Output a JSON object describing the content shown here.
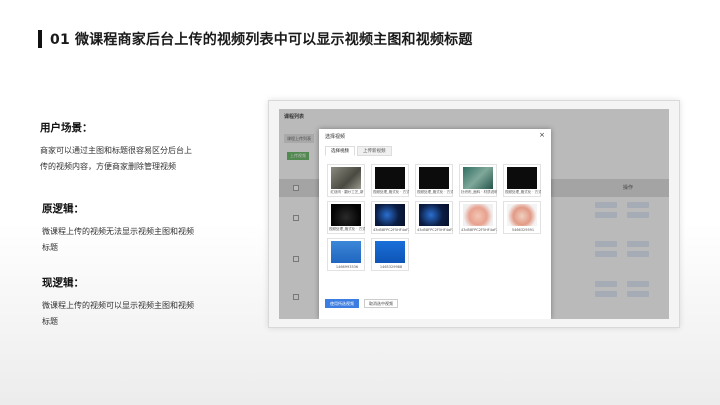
{
  "header": {
    "title": "01 微课程商家后台上传的视频列表中可以显示视频主图和视频标题"
  },
  "sections": {
    "user_scene": {
      "heading": "用户场景：",
      "line1": "商家可以通过主图和标题很容易区分后台上",
      "line2": "传的视频内容，方便商家删除管理视频"
    },
    "original": {
      "heading": "原逻辑：",
      "line1": "微课程上传的视频无法显示视频主图和视频",
      "line2": "标题"
    },
    "current": {
      "heading": "现逻辑：",
      "line1": "微课程上传的视频可以显示视频主图和视频",
      "line2": "标题"
    }
  },
  "screenshot": {
    "bg_title": "课程列表",
    "bg_tab": "课程上传列表",
    "bg_add_button": "上传视频",
    "bg_col_action": "操作",
    "modal": {
      "title": "选择视频",
      "close": "×",
      "tabs": [
        "选择视频",
        "上传新视频"
      ],
      "cards": [
        {
          "thumb": "food",
          "caption": "红烧肉 · 翻炒工艺_新"
        },
        {
          "thumb": "dark",
          "caption": "视频处理_格式化 · 方式"
        },
        {
          "thumb": "dark",
          "caption": "视频处理_格式化 · 方式"
        },
        {
          "thumb": "green",
          "caption": "针织布_面料 · 材质说明"
        },
        {
          "thumb": "dark",
          "caption": "视频处理_格式化 · 方式"
        },
        {
          "thumb": "dotdark",
          "caption": "视频处理_格式化 · 方式"
        },
        {
          "thumb": "blue",
          "caption": "43d58FPC2F5HF4aFX2"
        },
        {
          "thumb": "blue",
          "caption": "43d58FPC2F5HF4aFX2"
        },
        {
          "thumb": "baby",
          "caption": "43d58FPC2F5HF4aFX2"
        },
        {
          "thumb": "baby2",
          "caption": "5466329591"
        },
        {
          "thumb": "blueimg",
          "caption": "1466993536"
        },
        {
          "thumb": "promo",
          "caption": "1465329988"
        }
      ],
      "footer": {
        "confirm": "使用所选视频",
        "cancel": "取消选中视频"
      }
    }
  }
}
